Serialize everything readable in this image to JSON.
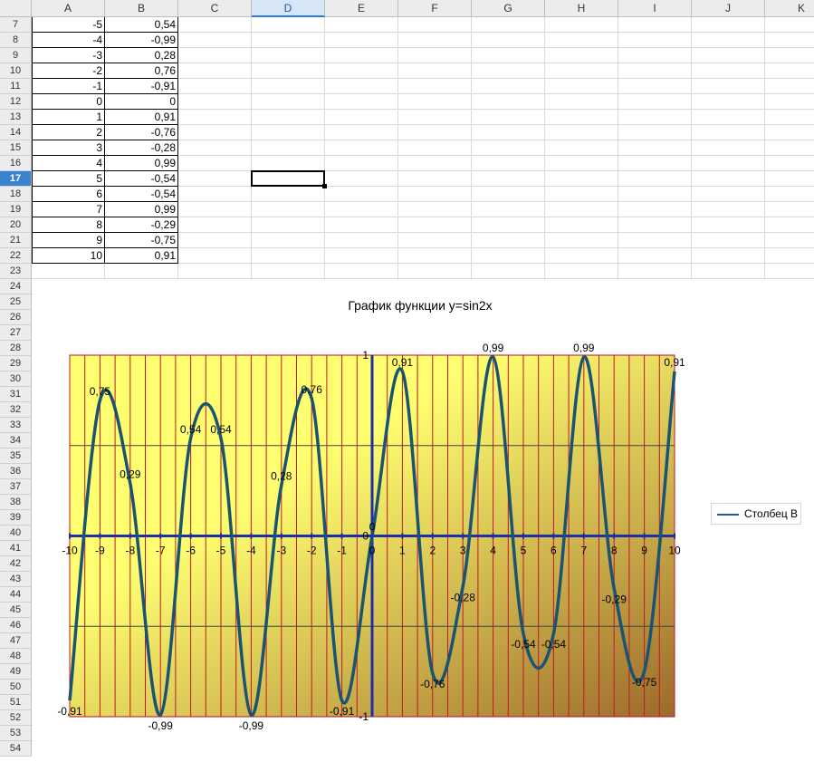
{
  "columns": [
    "A",
    "B",
    "C",
    "D",
    "E",
    "F",
    "G",
    "H",
    "I",
    "J",
    "K"
  ],
  "active_column": "D",
  "rows": [
    7,
    8,
    9,
    10,
    11,
    12,
    13,
    14,
    15,
    16,
    17,
    18,
    19,
    20,
    21,
    22,
    23,
    24,
    25,
    26,
    27,
    28,
    29,
    30,
    31,
    32,
    33,
    34,
    35,
    36,
    37,
    38,
    39,
    40,
    41,
    42,
    43,
    44,
    45,
    46,
    47,
    48,
    49,
    50,
    51,
    52,
    53,
    54
  ],
  "active_row": 17,
  "table": [
    [
      "-5",
      "0,54"
    ],
    [
      "-4",
      "-0,99"
    ],
    [
      "-3",
      "0,28"
    ],
    [
      "-2",
      "0,76"
    ],
    [
      "-1",
      "-0,91"
    ],
    [
      "0",
      "0"
    ],
    [
      "1",
      "0,91"
    ],
    [
      "2",
      "-0,76"
    ],
    [
      "3",
      "-0,28"
    ],
    [
      "4",
      "0,99"
    ],
    [
      "5",
      "-0,54"
    ],
    [
      "6",
      "-0,54"
    ],
    [
      "7",
      "0,99"
    ],
    [
      "8",
      "-0,29"
    ],
    [
      "9",
      "-0,75"
    ],
    [
      "10",
      "0,91"
    ]
  ],
  "colors": {
    "curve": "#1b5373",
    "axis": "#1c2fa8",
    "grid_v": "#c0182a",
    "plot_left": "#ffff70",
    "plot_right": "#9c6a2a",
    "header_bg": "#ececec",
    "active_header": "#3a83d1"
  },
  "chart_data": {
    "type": "line",
    "title": "График функции y=sin2x",
    "xlim": [
      -10,
      10
    ],
    "ylim": [
      -1,
      1
    ],
    "x_ticks": [
      "-10",
      "-9",
      "-8",
      "-7",
      "-6",
      "-5",
      "-4",
      "-3",
      "-2",
      "-1",
      "0",
      "1",
      "2",
      "3",
      "4",
      "5",
      "6",
      "7",
      "8",
      "9",
      "10"
    ],
    "y_ticks": [
      "-1",
      "0",
      "1"
    ],
    "legend": "top-right",
    "series": [
      {
        "name": "Столбец B",
        "x": [
          -10,
          -9,
          -8,
          -7,
          -6,
          -5,
          -4,
          -3,
          -2,
          -1,
          0,
          1,
          2,
          3,
          4,
          5,
          6,
          7,
          8,
          9,
          10
        ],
        "values": [
          -0.91,
          0.75,
          0.29,
          -0.99,
          0.54,
          0.54,
          -0.99,
          0.28,
          0.76,
          -0.91,
          0,
          0.91,
          -0.76,
          -0.28,
          0.99,
          -0.54,
          -0.54,
          0.99,
          -0.29,
          -0.75,
          0.91
        ],
        "labels": [
          "-0,91",
          "0,75",
          "0,29",
          "-0,99",
          "0,54",
          "0,54",
          "-0,99",
          "0,28",
          "0,76",
          "-0,91",
          "0",
          "0,91",
          "-0,76",
          "-0,28",
          "0,99",
          "-0,54",
          "-0,54",
          "0,99",
          "-0,29",
          "-0,75",
          "0,91"
        ]
      }
    ]
  }
}
